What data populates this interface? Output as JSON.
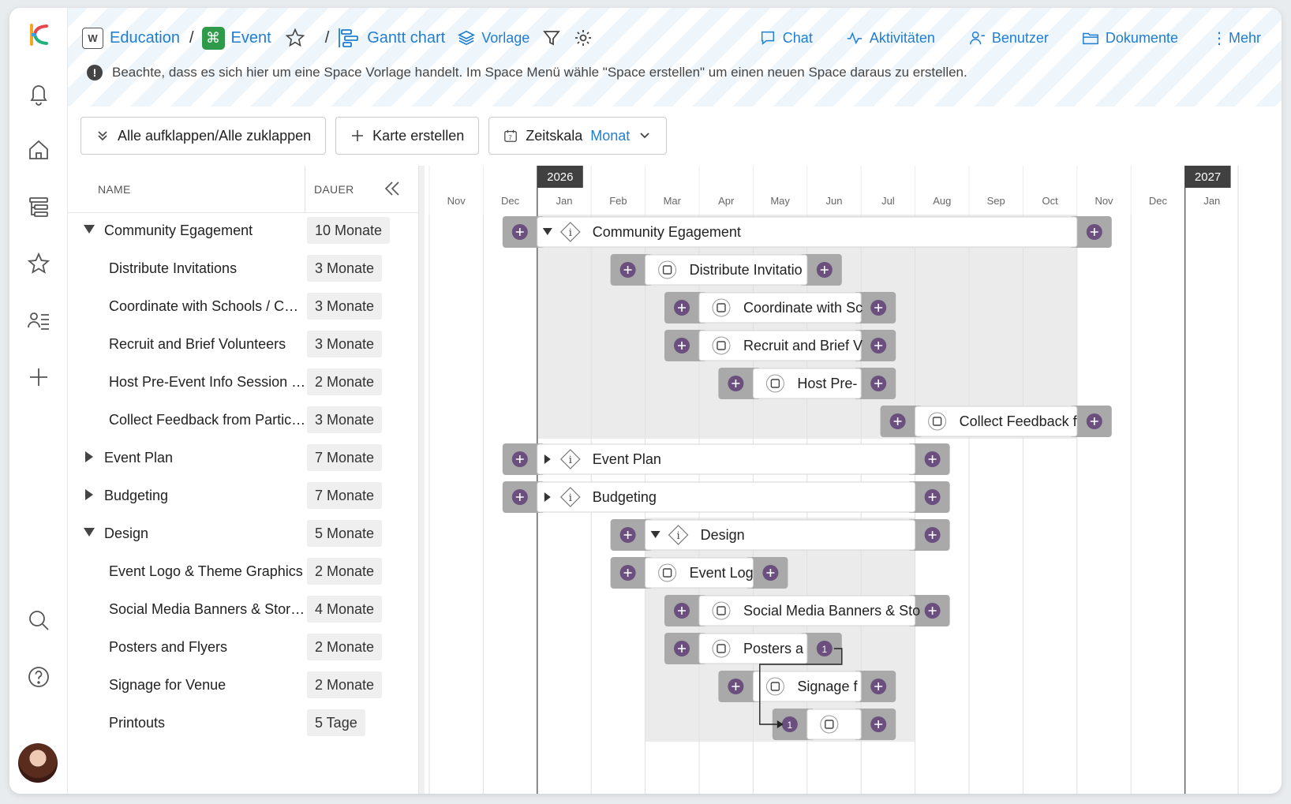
{
  "breadcrumb": {
    "workspace_icon": "W",
    "workspace": "Education",
    "space": "Event",
    "view": "Gantt chart",
    "template": "Vorlage"
  },
  "nav": {
    "chat": "Chat",
    "activities": "Aktivitäten",
    "users": "Benutzer",
    "documents": "Dokumente",
    "more": "Mehr"
  },
  "notice": "Beachte, dass es sich hier um eine Space Vorlage handelt. Im Space Menü wähle \"Space erstellen\" um einen neuen Space daraus zu erstellen.",
  "toolbar": {
    "expand_collapse": "Alle aufklappen/Alle zuklappen",
    "create_card": "Karte erstellen",
    "timescale_label": "Zeitskala",
    "timescale_value": "Monat"
  },
  "grid": {
    "col_name": "NAME",
    "col_duration": "DAUER",
    "rows": [
      {
        "name": "Community Egagement",
        "duration": "10 Monate",
        "level": 0,
        "state": "expanded"
      },
      {
        "name": "Distribute Invitations",
        "duration": "3 Monate",
        "level": 1
      },
      {
        "name": "Coordinate with Schools / Com...",
        "duration": "3 Monate",
        "level": 1
      },
      {
        "name": "Recruit and Brief Volunteers",
        "duration": "3 Monate",
        "level": 1
      },
      {
        "name": "Host Pre-Event Info Session / Q...",
        "duration": "2 Monate",
        "level": 1
      },
      {
        "name": "Collect Feedback from Participa...",
        "duration": "3 Monate",
        "level": 1
      },
      {
        "name": "Event Plan",
        "duration": "7 Monate",
        "level": 0,
        "state": "collapsed"
      },
      {
        "name": "Budgeting",
        "duration": "7 Monate",
        "level": 0,
        "state": "collapsed"
      },
      {
        "name": "Design",
        "duration": "5 Monate",
        "level": 0,
        "state": "expanded"
      },
      {
        "name": "Event Logo & Theme Graphics",
        "duration": "2 Monate",
        "level": 1
      },
      {
        "name": "Social Media Banners & Stories",
        "duration": "4 Monate",
        "level": 1
      },
      {
        "name": "Posters and Flyers",
        "duration": "2 Monate",
        "level": 1
      },
      {
        "name": "Signage for Venue",
        "duration": "2 Monate",
        "level": 1
      },
      {
        "name": "Printouts",
        "duration": "5 Tage",
        "level": 1
      }
    ]
  },
  "timeline": {
    "years": [
      "2026",
      "2027"
    ],
    "months": [
      "Nov",
      "Dec",
      "Jan",
      "Feb",
      "Mar",
      "Apr",
      "May",
      "Jun",
      "Jul",
      "Aug",
      "Sep",
      "Oct",
      "Nov",
      "Dec",
      "Jan"
    ],
    "bars": [
      {
        "label": "Community Egagement",
        "kind": "group",
        "expanded": true,
        "start": 2,
        "end": 12
      },
      {
        "label": "Distribute Invitatio",
        "kind": "task",
        "start": 4,
        "end": 7
      },
      {
        "label": "Coordinate with Sc",
        "kind": "task",
        "start": 5,
        "end": 8
      },
      {
        "label": "Recruit and Brief V",
        "kind": "task",
        "start": 5,
        "end": 8
      },
      {
        "label": "Host Pre-",
        "kind": "task",
        "start": 6,
        "end": 8
      },
      {
        "label": "Collect Feedback f",
        "kind": "task",
        "start": 9,
        "end": 12
      },
      {
        "label": "Event Plan",
        "kind": "group",
        "expanded": false,
        "start": 2,
        "end": 9
      },
      {
        "label": "Budgeting",
        "kind": "group",
        "expanded": false,
        "start": 2,
        "end": 9
      },
      {
        "label": "Design",
        "kind": "group",
        "expanded": true,
        "start": 4,
        "end": 9
      },
      {
        "label": "Event Log",
        "kind": "task",
        "start": 4,
        "end": 6
      },
      {
        "label": "Social Media Banners & Sto",
        "kind": "task",
        "start": 5,
        "end": 9
      },
      {
        "label": "Posters a",
        "kind": "task",
        "start": 5,
        "end": 7,
        "dep_out": "1"
      },
      {
        "label": "Signage f",
        "kind": "task",
        "start": 6,
        "end": 8
      },
      {
        "label": "",
        "kind": "milestone",
        "start": 7,
        "end": 8,
        "dep_in": "1"
      }
    ]
  },
  "colors": {
    "accent": "#1f7ed1",
    "plus_circle": "#6b4f7e",
    "handle": "#a9a9a9",
    "band": "#ebebeb",
    "year_badge": "#404040"
  }
}
